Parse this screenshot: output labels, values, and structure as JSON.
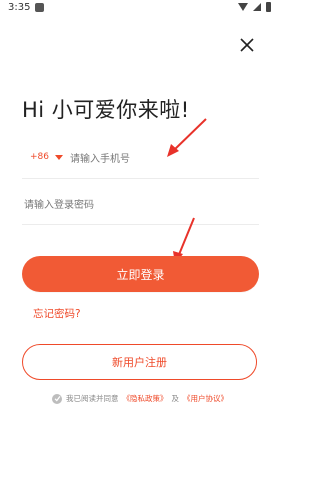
{
  "status_bar": {
    "time": "3:35"
  },
  "greeting": "Hi 小可爱你来啦!",
  "phone": {
    "country_code": "+86",
    "placeholder": "请输入手机号"
  },
  "password": {
    "placeholder": "请输入登录密码"
  },
  "buttons": {
    "login": "立即登录",
    "register": "新用户注册"
  },
  "links": {
    "forgot_password": "忘记密码?"
  },
  "agreement": {
    "prefix": "我已阅读并同意",
    "privacy": "《隐私政策》",
    "and": "及",
    "user_agreement": "《用户协议》"
  },
  "colors": {
    "accent": "#f15a35"
  },
  "icons": {
    "close": "close-icon",
    "check": "check-icon"
  }
}
